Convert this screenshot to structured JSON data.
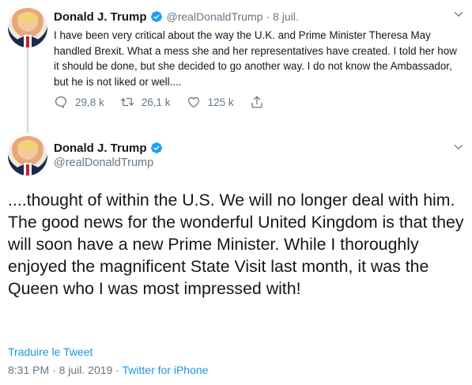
{
  "tweet1": {
    "author_name": "Donald J. Trump",
    "handle": "@realDonaldTrump",
    "separator": "·",
    "date": "8 juil.",
    "text": "I have been very critical about the way the U.K. and Prime Minister Theresa May handled Brexit. What a mess she and her representatives have created. I told her how it should be done, but she decided to go another way. I do not know the Ambassador, but he is not liked or well....",
    "replies": "29,8 k",
    "retweets": "26,1 k",
    "likes": "125 k"
  },
  "tweet2": {
    "author_name": "Donald J. Trump",
    "handle": "@realDonaldTrump",
    "text": "....thought of within the U.S. We will no longer deal with him. The good news for the wonderful United Kingdom is that they will soon have a new Prime Minister. While I thoroughly enjoyed the magnificent State Visit last month, it was the Queen who I was most impressed with!",
    "translate_label": "Traduire le Tweet",
    "timestamp": "8:31 PM · 8 juil. 2019",
    "source_separator": " · ",
    "source": "Twitter for iPhone"
  },
  "icons": {
    "verified": "verified-badge-icon",
    "chevron": "chevron-down-icon",
    "reply": "reply-icon",
    "retweet": "retweet-icon",
    "like": "heart-icon",
    "share": "share-icon"
  },
  "colors": {
    "text": "#14171a",
    "muted": "#657786",
    "link": "#1b95e0",
    "verified": "#1da1f2",
    "thread_line": "#ccd6dd"
  }
}
